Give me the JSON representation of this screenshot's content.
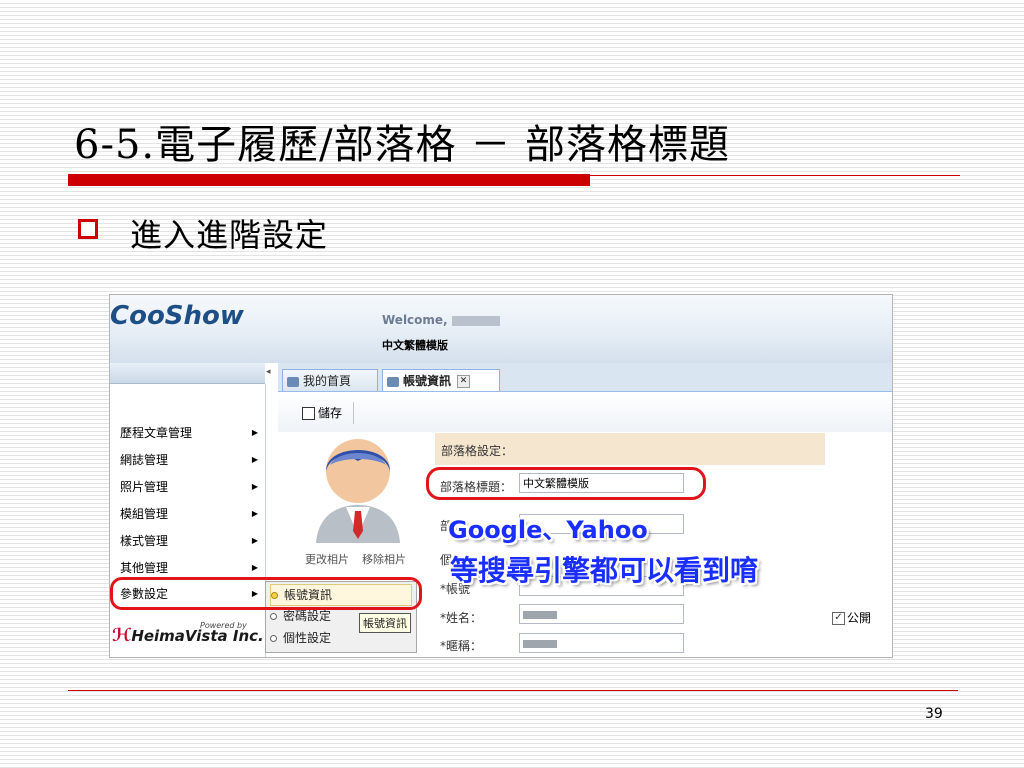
{
  "slide": {
    "title": "6-5.電子履歷/部落格 － 部落格標題",
    "bullet": "進入進階設定",
    "page_number": "39"
  },
  "app": {
    "logo": "CooShow",
    "welcome": "Welcome,",
    "site_name": "中文繁體模版"
  },
  "sidebar": {
    "items": [
      {
        "label": "歷程文章管理"
      },
      {
        "label": "網誌管理"
      },
      {
        "label": "照片管理"
      },
      {
        "label": "模組管理"
      },
      {
        "label": "樣式管理"
      },
      {
        "label": "其他管理"
      },
      {
        "label": "參數設定"
      }
    ],
    "powered_by": "Powered by",
    "company": "HeimaVista Inc."
  },
  "tabs": [
    {
      "label": "我的首頁"
    },
    {
      "label": "帳號資訊"
    }
  ],
  "toolbar": {
    "save_label": "儲存"
  },
  "profile": {
    "change_photo": "更改相片",
    "delete_photo": "移除相片"
  },
  "form": {
    "section_title": "部落格設定：",
    "blog_title_label": "部落格標題：",
    "blog_title_value": "中文繁體模版",
    "row3_label": "部",
    "row4_label": "個",
    "account_label": "*帳號",
    "name_label": "*姓名：",
    "nickname_label": "*暱稱：",
    "public_label": "公開"
  },
  "submenu": {
    "items": [
      {
        "label": "帳號資訊"
      },
      {
        "label": "密碼設定"
      },
      {
        "label": "個性設定"
      }
    ],
    "tooltip": "帳號資訊"
  },
  "annotation": {
    "line1": "Google、Yahoo",
    "line2": "等搜尋引擎都可以看到唷"
  },
  "colors": {
    "accent_red": "#cc0000",
    "highlight_red": "#e1141a",
    "annotation_blue": "#1a2fff",
    "header_blue": "#1d4f86"
  }
}
